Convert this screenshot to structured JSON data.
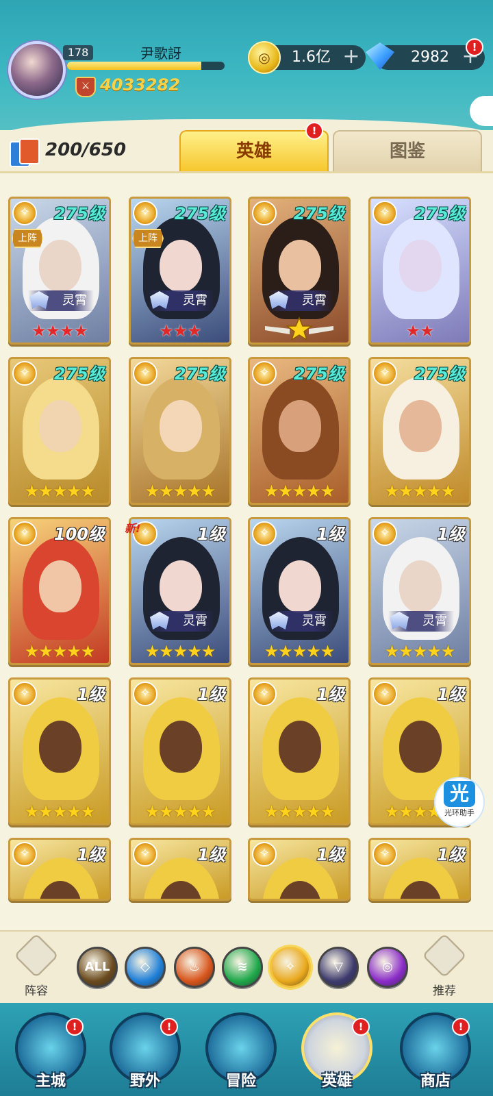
{
  "player": {
    "level": "178",
    "name": "尹歌訝",
    "power": "4033282",
    "xp_fraction": 0.85
  },
  "currency": {
    "gold": "1.6亿",
    "gems": "2982",
    "plus": "+"
  },
  "hero_count": "200/650",
  "tabs": {
    "heroes": "英雄",
    "codex": "图鉴",
    "notif": "!"
  },
  "card_labels": {
    "deployed": "上阵",
    "awaken": "灵霄",
    "new": "新!"
  },
  "heroes": [
    {
      "level": "275级",
      "deployed": true,
      "awaken": true,
      "stars": "★★★★",
      "star_color": "red",
      "theme": "silver"
    },
    {
      "level": "275级",
      "deployed": true,
      "awaken": true,
      "stars": "★★★",
      "star_color": "red",
      "theme": "dark"
    },
    {
      "level": "275级",
      "deployed": false,
      "awaken": true,
      "stars": "",
      "star_color": "gold",
      "theme": "brown",
      "big_star": true
    },
    {
      "level": "275级",
      "deployed": false,
      "awaken": false,
      "stars": "★★",
      "star_color": "red",
      "theme": "lilac"
    },
    {
      "level": "275级",
      "deployed": false,
      "awaken": false,
      "stars": "★★★★★",
      "star_color": "gold",
      "theme": "yellow"
    },
    {
      "level": "275级",
      "deployed": false,
      "awaken": false,
      "stars": "★★★★★",
      "star_color": "gold",
      "theme": "amber"
    },
    {
      "level": "275级",
      "deployed": false,
      "awaken": false,
      "stars": "★★★★★",
      "star_color": "gold",
      "theme": "bronze"
    },
    {
      "level": "275级",
      "deployed": false,
      "awaken": false,
      "stars": "★★★★★",
      "star_color": "gold",
      "theme": "gold"
    },
    {
      "level": "100级",
      "deployed": false,
      "awaken": false,
      "stars": "★★★★★",
      "star_color": "gold",
      "theme": "red"
    },
    {
      "level": "1级",
      "deployed": false,
      "awaken": true,
      "stars": "★★★★★",
      "star_color": "gold",
      "theme": "dark",
      "new": true
    },
    {
      "level": "1级",
      "deployed": false,
      "awaken": true,
      "stars": "★★★★★",
      "star_color": "gold",
      "theme": "dark"
    },
    {
      "level": "1级",
      "deployed": false,
      "awaken": true,
      "stars": "★★★★★",
      "star_color": "gold",
      "theme": "silver"
    },
    {
      "level": "1级",
      "deployed": false,
      "awaken": false,
      "stars": "★★★★★",
      "star_color": "gold",
      "theme": "holy"
    },
    {
      "level": "1级",
      "deployed": false,
      "awaken": false,
      "stars": "★★★★★",
      "star_color": "gold",
      "theme": "holy"
    },
    {
      "level": "1级",
      "deployed": false,
      "awaken": false,
      "stars": "★★★★★",
      "star_color": "gold",
      "theme": "holy"
    },
    {
      "level": "1级",
      "deployed": false,
      "awaken": false,
      "stars": "★★★★★",
      "star_color": "gold",
      "theme": "holy"
    },
    {
      "level": "1级",
      "deployed": false,
      "awaken": false,
      "stars": "",
      "star_color": "gold",
      "theme": "holy"
    },
    {
      "level": "1级",
      "deployed": false,
      "awaken": false,
      "stars": "",
      "star_color": "gold",
      "theme": "holy"
    },
    {
      "level": "1级",
      "deployed": false,
      "awaken": false,
      "stars": "",
      "star_color": "gold",
      "theme": "holy"
    },
    {
      "level": "1级",
      "deployed": false,
      "awaken": false,
      "stars": "",
      "star_color": "gold",
      "theme": "holy"
    }
  ],
  "filters": {
    "lineup": "阵容",
    "recommend": "推荐",
    "all": "ALL",
    "items": [
      {
        "name": "all",
        "color": "#6a4a1e",
        "icon": "all-icon"
      },
      {
        "name": "water",
        "color": "#1f7fd8",
        "icon": "water-icon"
      },
      {
        "name": "fire",
        "color": "#d8551c",
        "icon": "fire-icon"
      },
      {
        "name": "wind",
        "color": "#1fa84a",
        "icon": "wind-icon"
      },
      {
        "name": "light",
        "color": "#e9a81c",
        "icon": "light-icon",
        "active": true
      },
      {
        "name": "dark-void",
        "color": "#3d3a6e",
        "icon": "void-icon"
      },
      {
        "name": "shadow",
        "color": "#8a2cc8",
        "icon": "shadow-icon"
      }
    ]
  },
  "nav": {
    "city": "主城",
    "wild": "野外",
    "adventure": "冒险",
    "heroes": "英雄",
    "shop": "商店"
  },
  "helper": {
    "icon_char": "光",
    "label": "光环助手"
  }
}
